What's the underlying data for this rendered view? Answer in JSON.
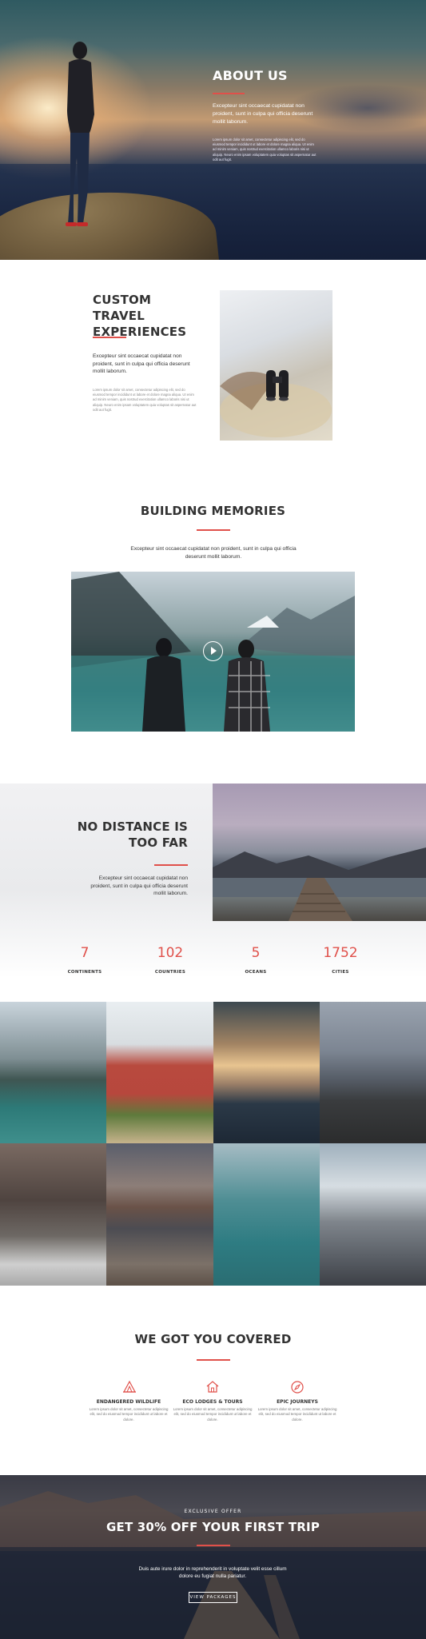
{
  "about": {
    "title": "ABOUT US",
    "lead": "Excepteur sint occaecat cupidatat non proident, sunt in culpa qui officia deserunt mollit laborum.",
    "body": "Lorem ipsum dolor sit amet, consectetur adipiscing elit, sed do eiusmod tempor incididunt ut labore et dolore magna aliqua. Ut enim ad minim veniam, quis nostrud exercitation ullamco laboris nisi ut aliquip. Neuro enim ipsam voluptatem quia voluptas sit aspernatur aut odit aut fugit."
  },
  "custom": {
    "title": "CUSTOM TRAVEL EXPERIENCES",
    "lead": "Excepteur sint occaecat cupidatat non proident, sunt in culpa qui officia deserunt mollit laborum.",
    "body": "Lorem ipsum dolor sit amet, consectetur adipiscing elit, sed do eiusmod tempor incididunt ut labore et dolore magna aliqua. Ut enim ad minim veniam, quis nostrud exercitation ullamco laboris nisi ut aliquip. Neuro enim ipsam voluptatem quia voluptas sit aspernatur aut odit aut fugit."
  },
  "memories": {
    "title": "BUILDING MEMORIES",
    "lead": "Excepteur sint occaecat cupidatat non proident, sunt in culpa qui officia deserunt mollit laborum."
  },
  "distance": {
    "title": "NO DISTANCE IS TOO FAR",
    "lead": "Excepteur sint occaecat cupidatat non proident, sunt in culpa qui officia deserunt mollit laborum."
  },
  "stats": [
    {
      "value": "7",
      "label": "CONTINENTS"
    },
    {
      "value": "102",
      "label": "COUNTRIES"
    },
    {
      "value": "5",
      "label": "OCEANS"
    },
    {
      "value": "1752",
      "label": "CITIES"
    }
  ],
  "covered": {
    "title": "WE GOT YOU COVERED",
    "features": [
      {
        "icon": "tent-icon",
        "title": "ENDANGERED WILDLIFE",
        "desc": "Lorem ipsum dolor sit amet, consectetur adipiscing elit, sed do eiusmod tempor incididunt ut labore et dolore."
      },
      {
        "icon": "house-icon",
        "title": "ECO LODGES & TOURS",
        "desc": "Lorem ipsum dolor sit amet, consectetur adipiscing elit, sed do eiusmod tempor incididunt ut labore et dolore."
      },
      {
        "icon": "compass-icon",
        "title": "EPIC JOURNEYS",
        "desc": "Lorem ipsum dolor sit amet, consectetur adipiscing elit, sed do eiusmod tempor incididunt ut labore et dolore."
      }
    ]
  },
  "cta": {
    "eyebrow": "EXCLUSIVE OFFER",
    "title": "GET 30% OFF YOUR FIRST TRIP",
    "lead": "Duis aute irure dolor in reprehenderit in voluptate velit esse cillum dolore eu fugiat nulla pariatur.",
    "button": "VIEW PACKAGES"
  },
  "colors": {
    "accent": "#e0504a",
    "text": "#333333"
  }
}
